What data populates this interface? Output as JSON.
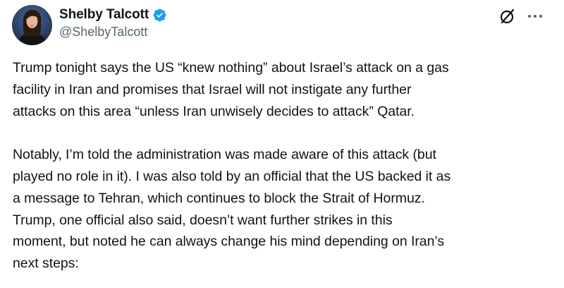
{
  "author": {
    "display_name": "Shelby Talcott",
    "handle": "@ShelbyTalcott",
    "verified": true,
    "verified_color": "#1d9bf0"
  },
  "actions": {
    "grok_icon": "grok-slash-circle-icon",
    "more_icon": "more-horizontal-icon"
  },
  "tweet": {
    "paragraph_1": "Trump tonight says the US “knew nothing” about Israel’s attack on a gas\nfacility in Iran and promises that Israel will not instigate any further\nattacks on this area “unless Iran unwisely decides to attack” Qatar.",
    "paragraph_2": "Notably, I’m told the administration was made aware of this attack (but\nplayed no role in it). I was also told by an official that the US backed it as\na message to Tehran, which continues to block the Strait of Hormuz.\nTrump, one official also said, doesn’t want further strikes in this\nmoment, but noted he can always change his mind depending on Iran’s\nnext steps:"
  },
  "colors": {
    "text_primary": "#0f1419",
    "text_secondary": "#536471",
    "background": "#ffffff"
  }
}
